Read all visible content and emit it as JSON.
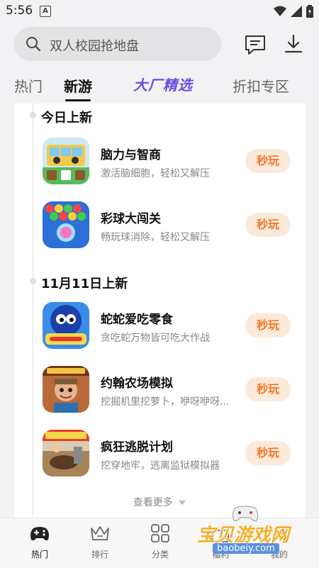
{
  "status": {
    "time": "5:56",
    "notif": "A"
  },
  "search": {
    "placeholder": "双人校园抢地盘"
  },
  "tabs": [
    {
      "label": "热门"
    },
    {
      "label": "新游"
    },
    {
      "label": "大厂精选"
    },
    {
      "label": "折扣专区"
    }
  ],
  "sections": [
    {
      "title": "今日上新"
    },
    {
      "title": "11月11日上新"
    }
  ],
  "games": [
    {
      "name": "脑力与智商",
      "desc": "激活脑细胞，轻松又解压",
      "button": "秒玩"
    },
    {
      "name": "彩球大闯关",
      "desc": "畅玩球消除，轻松又解压",
      "button": "秒玩"
    },
    {
      "name": "蛇蛇爱吃零食",
      "desc": "贪吃蛇万物皆可吃大作战",
      "button": "秒玩"
    },
    {
      "name": "约翰农场模拟",
      "desc": "挖掘机里挖萝卜，咿呀咿呀...",
      "button": "秒玩"
    },
    {
      "name": "疯狂逃脱计划",
      "desc": "挖穿地牢，逃离监狱模拟器",
      "button": "秒玩"
    }
  ],
  "more": "查看更多",
  "nav": [
    {
      "label": "热门"
    },
    {
      "label": "排行"
    },
    {
      "label": "分类"
    },
    {
      "label": "福利"
    },
    {
      "label": "我的"
    }
  ],
  "watermark": {
    "text": "宝贝游戏网",
    "url": "baobeiy.com"
  },
  "colors": {
    "accent": "#f07a2a",
    "featured": "#6b4de6",
    "button_bg": "#fde9d9"
  }
}
